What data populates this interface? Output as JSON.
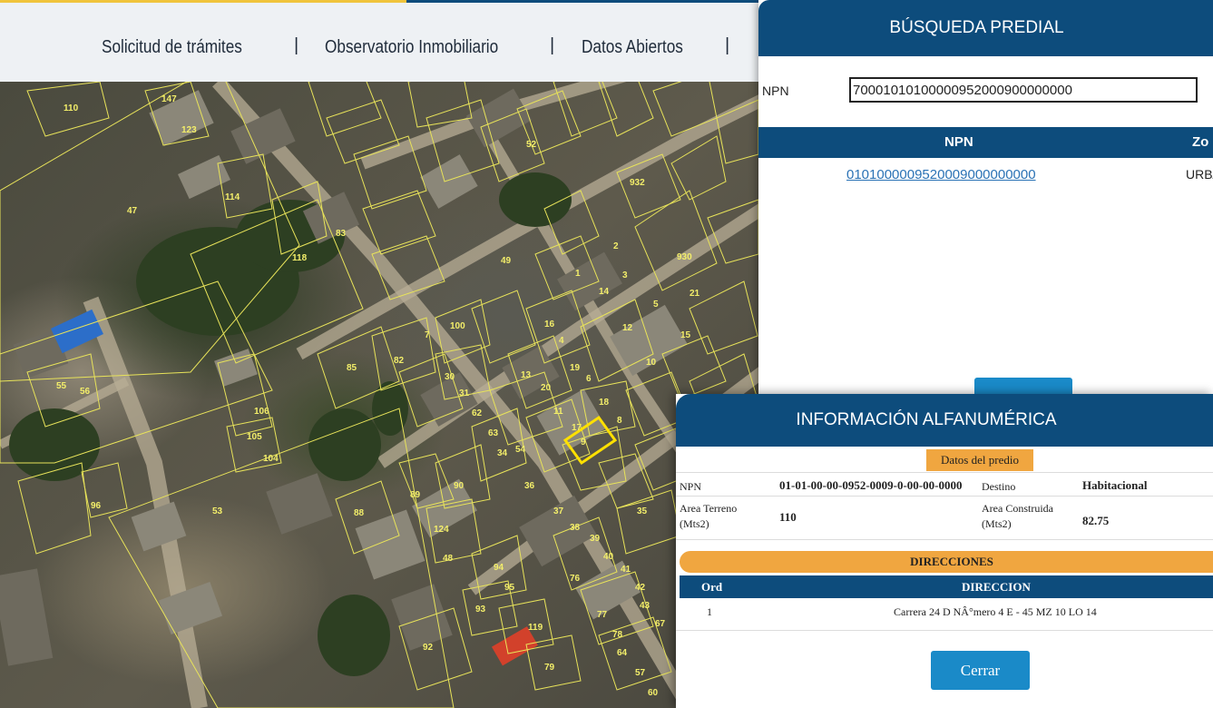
{
  "nav": {
    "items": [
      "Solicitud de trámites",
      "Observatorio Inmobiliario",
      "Datos Abiertos"
    ],
    "separator": "|"
  },
  "busqueda": {
    "title": "BÚSQUEDA PREDIAL",
    "npn_label": "NPN",
    "npn_value": "70001010100000952000900000000",
    "results_header": {
      "npn": "NPN",
      "zona": "Zo"
    },
    "result": {
      "npn": "0101000009520009000000000",
      "zona": "URB/"
    }
  },
  "info": {
    "title": "INFORMACIÓN ALFANUMÉRICA",
    "section_label": "Datos del predio",
    "npn_label": "NPN",
    "npn_value": "01-01-00-00-0952-0009-0-00-00-0000",
    "destino_label": "Destino",
    "destino_value": "Habitacional",
    "area_terreno_label": "Area Terreno (Mts2)",
    "area_terreno_value": "110",
    "area_construida_label": "Area Construida (Mts2)",
    "area_construida_value": "82.75",
    "direcciones_title": "DIRECCIONES",
    "dir_cols": {
      "ord": "Ord",
      "direccion": "DIRECCION"
    },
    "dir_rows": [
      {
        "ord": "1",
        "direccion": "Carrera 24 D NÂ°mero 4 E - 45 MZ 10 LO 14"
      }
    ],
    "close_label": "Cerrar"
  },
  "map": {
    "parcel_labels": [
      "110",
      "147",
      "123",
      "114",
      "47",
      "118",
      "83",
      "55",
      "56",
      "85",
      "82",
      "106",
      "105",
      "104",
      "96",
      "53",
      "88",
      "89",
      "90",
      "124",
      "48",
      "94",
      "95",
      "93",
      "119",
      "92",
      "79",
      "76",
      "77",
      "78",
      "64",
      "67",
      "42",
      "43",
      "41",
      "40",
      "39",
      "38",
      "37",
      "35",
      "36",
      "34",
      "63",
      "62",
      "31",
      "30",
      "20",
      "19",
      "18",
      "17",
      "16",
      "15",
      "14",
      "13",
      "12",
      "11",
      "10",
      "9",
      "8",
      "7",
      "6",
      "5",
      "4",
      "3",
      "2",
      "1",
      "930",
      "932",
      "100",
      "21",
      "52",
      "49",
      "54",
      "57",
      "60"
    ],
    "colors": {
      "parcel": "#e8e35a",
      "selected": "#ffe000",
      "header": "#0d4c7c",
      "accent": "#f0a640",
      "button": "#1a8ac8"
    }
  }
}
